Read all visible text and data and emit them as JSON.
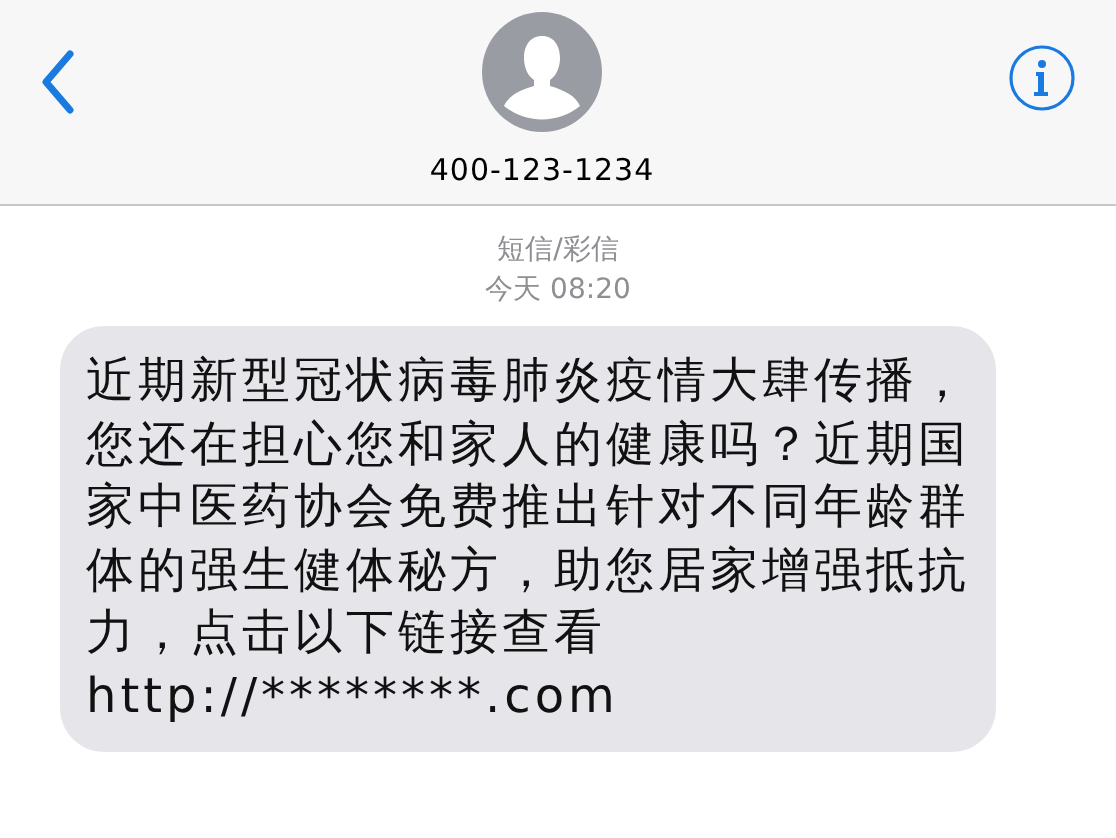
{
  "header": {
    "contact": "400-123-1234"
  },
  "meta": {
    "channel": "短信/彩信",
    "time": "今天 08:20"
  },
  "message": {
    "lines": [
      "近期新型冠状病毒肺炎疫情大肆传播，",
      "您还在担心您和家人的健康吗？近期国",
      "家中医药协会免费推出针对不同年龄群",
      "体的强生健体秘方，助您居家增强抵抗",
      "力，点击以下链接查看",
      "http://********.com"
    ]
  }
}
